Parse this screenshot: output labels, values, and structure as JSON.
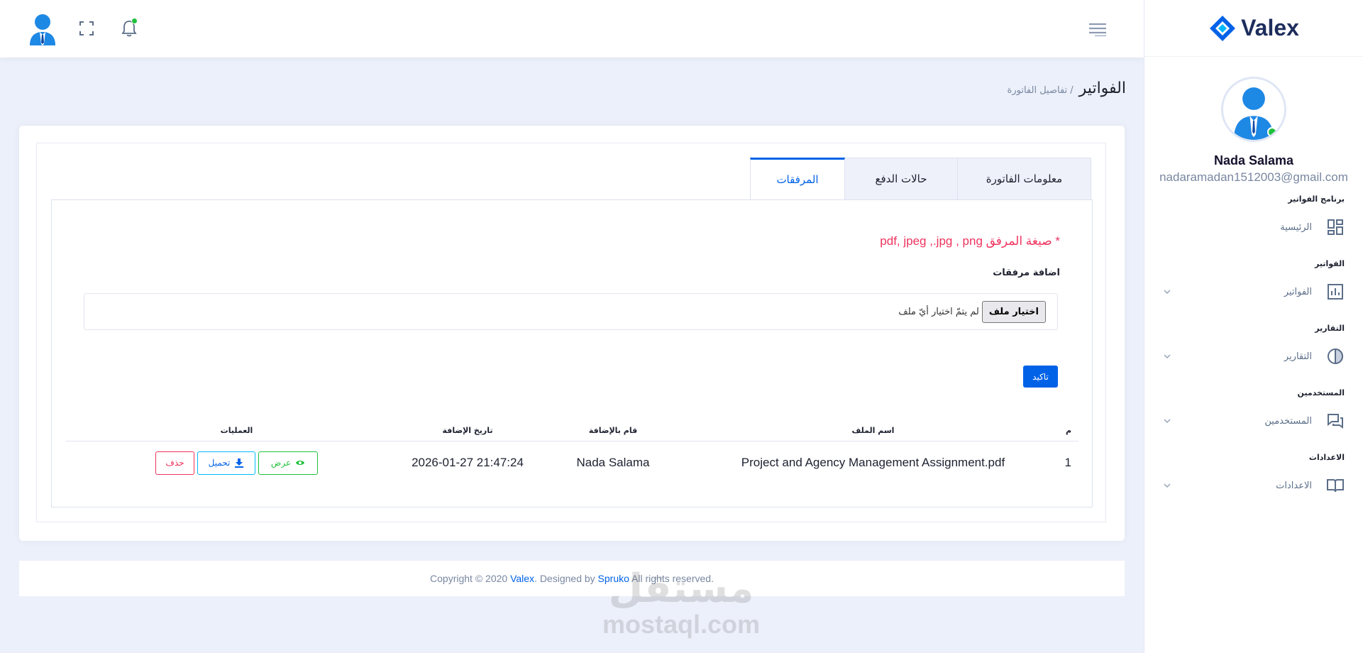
{
  "brand": {
    "name": "Valex"
  },
  "user": {
    "name": "Nada Salama",
    "email": "nadaramadan1512003@gmail.com"
  },
  "sidebar": {
    "sections": [
      {
        "category": "برنامج الفواتير",
        "item": "الرئيسية",
        "icon": "dashboard-icon",
        "chevron": false
      },
      {
        "category": "الفواتير",
        "item": "الفواتير",
        "icon": "bar-chart-icon",
        "chevron": true
      },
      {
        "category": "التقارير",
        "item": "التقارير",
        "icon": "pie-chart-icon",
        "chevron": true
      },
      {
        "category": "المستخدمين",
        "item": "المستخدمين",
        "icon": "chat-icon",
        "chevron": true
      },
      {
        "category": "الاعدادات",
        "item": "الاعدادات",
        "icon": "book-icon",
        "chevron": true
      }
    ]
  },
  "breadcrumb": {
    "title": "الفواتير",
    "sub": "/ تفاصيل الفاتورة"
  },
  "tabs": [
    "معلومات الفاتورة",
    "حالات الدفع",
    "المرفقات"
  ],
  "attachments": {
    "format_note": "* صيغة المرفق pdf, jpeg ,.jpg , png",
    "add_label": "اضافة مرفقات",
    "file_button": "اختيار ملف",
    "file_status": "لم يتمّ اختيار أيّ ملف",
    "confirm": "تاكيد"
  },
  "table": {
    "headers": [
      "م",
      "اسم الملف",
      "قام بالإضافة",
      "تاريخ الإضافة",
      "العمليات"
    ],
    "rows": [
      {
        "index": "1",
        "file": "Project and Agency Management Assignment.pdf",
        "added_by": "Nada Salama",
        "date": "2026-01-27 21:47:24"
      }
    ],
    "actions": {
      "view": "عرض",
      "download": "تحميل",
      "delete": "حذف"
    }
  },
  "footer": {
    "prefix": "Copyright © 2020 ",
    "brand": "Valex",
    "mid": ". Designed by ",
    "designer": "Spruko",
    "suffix": " All rights reserved."
  },
  "watermark": {
    "arabic": "مستقل",
    "latin": "mostaql.com"
  },
  "colors": {
    "primary": "#0162e8",
    "success": "#22c03c",
    "danger": "#ee335e",
    "info": "#00b9ff",
    "background": "#ecf0fa"
  }
}
